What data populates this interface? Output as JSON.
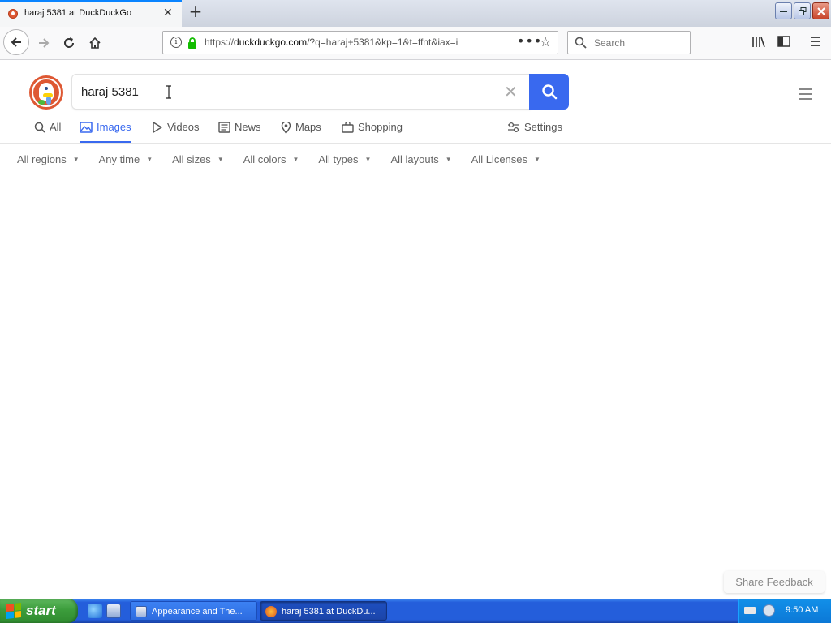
{
  "browser": {
    "tab": {
      "title": "haraj 5381 at DuckDuckGo"
    },
    "url": {
      "prefix": "https://",
      "host": "duckduckgo.com",
      "path": "/?q=haraj+5381&kp=1&t=ffnt&iax=i"
    },
    "search_placeholder": "Search"
  },
  "ddg": {
    "query": "haraj 5381",
    "tabs": [
      {
        "label": "All",
        "icon": "search-icon"
      },
      {
        "label": "Images",
        "icon": "image-icon",
        "active": true
      },
      {
        "label": "Videos",
        "icon": "play-icon"
      },
      {
        "label": "News",
        "icon": "newspaper-icon"
      },
      {
        "label": "Maps",
        "icon": "map-pin-icon"
      },
      {
        "label": "Shopping",
        "icon": "shopping-bag-icon"
      }
    ],
    "settings_label": "Settings",
    "filters": [
      "All regions",
      "Any time",
      "All sizes",
      "All colors",
      "All types",
      "All layouts",
      "All Licenses"
    ],
    "feedback_label": "Share Feedback",
    "accent_color": "#3969ef",
    "brand_color": "#de5833"
  },
  "taskbar": {
    "start_label": "start",
    "items": [
      {
        "label": "Appearance and The...",
        "active": false
      },
      {
        "label": "haraj 5381 at DuckDu...",
        "active": true
      }
    ],
    "clock": "9:50 AM"
  }
}
